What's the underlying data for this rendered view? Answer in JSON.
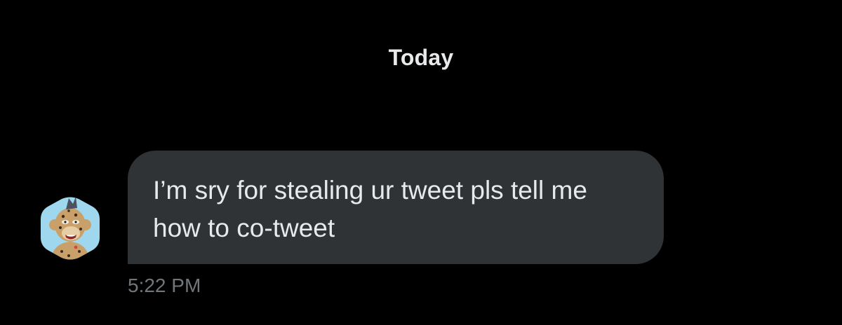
{
  "conversation": {
    "date_divider": "Today",
    "messages": [
      {
        "sender_avatar_icon": "ape-nft-avatar-icon",
        "text": "I’m sry for stealing ur tweet pls tell me how to co-tweet",
        "timestamp": "5:22 PM"
      }
    ]
  },
  "colors": {
    "background": "#000000",
    "bubble": "#2f3336",
    "text_primary": "#e7e9ea",
    "text_secondary": "#71767b",
    "avatar_bg": "#9fd8ee"
  }
}
